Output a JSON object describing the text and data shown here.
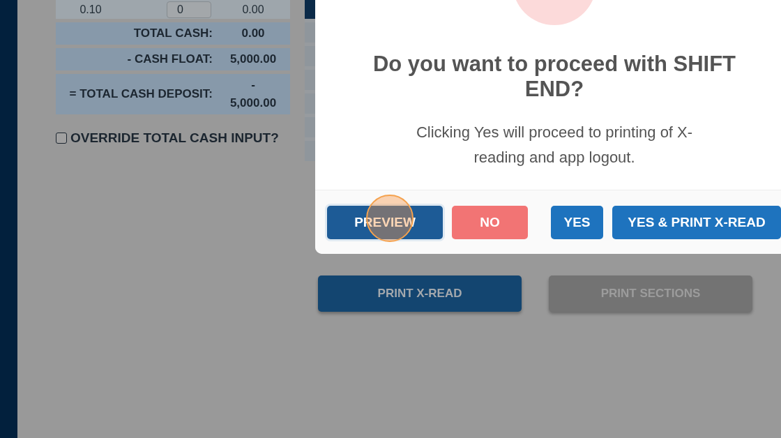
{
  "cash_table": {
    "denomination_row": {
      "denomination": "0.10",
      "count": "0",
      "amount": "0.00"
    },
    "totals": [
      {
        "label": "TOTAL CASH:",
        "value": "0.00"
      },
      {
        "label": "- CASH FLOAT:",
        "value": "5,000.00"
      },
      {
        "label": "= TOTAL CASH DEPOSIT:",
        "value": "- 5,000.00"
      }
    ]
  },
  "override_checkbox": {
    "label": "OVERRIDE TOTAL CASH INPUT?",
    "checked": false
  },
  "actions": [
    {
      "label": "PRINT X-READ",
      "disabled": false
    },
    {
      "label": "PRINT SECTIONS",
      "disabled": true
    }
  ],
  "dialog": {
    "title": "Do you want to proceed with SHIFT END?",
    "message": "Clicking Yes will proceed to printing of X-reading and app logout.",
    "buttons": [
      {
        "label": "PREVIEW",
        "kind": "primary",
        "focused": true
      },
      {
        "label": "NO",
        "kind": "cancel",
        "focused": false
      },
      {
        "label": "YES",
        "kind": "confirm",
        "focused": false
      },
      {
        "label": "YES & PRINT X-READ",
        "kind": "confirm",
        "focused": false
      }
    ]
  }
}
